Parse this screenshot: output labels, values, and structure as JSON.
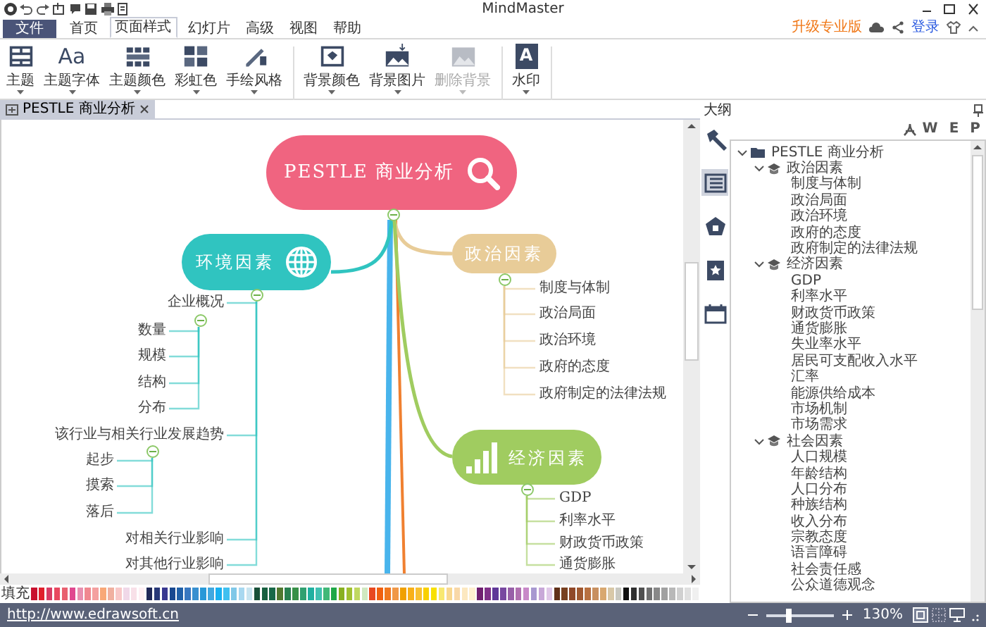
{
  "window": {
    "title": "MindMaster"
  },
  "menu_tabs": [
    {
      "label": "文件",
      "kind": "file",
      "selected": false
    },
    {
      "label": "首页",
      "kind": "tab",
      "selected": false
    },
    {
      "label": "页面样式",
      "kind": "tab",
      "selected": true
    },
    {
      "label": "幻灯片",
      "kind": "tab",
      "selected": false
    },
    {
      "label": "高级",
      "kind": "tab",
      "selected": false
    },
    {
      "label": "视图",
      "kind": "tab",
      "selected": false
    },
    {
      "label": "帮助",
      "kind": "tab",
      "selected": false
    }
  ],
  "account": {
    "upgrade": "升级专业版",
    "login": "登录"
  },
  "ribbon": {
    "groups": [
      {
        "items": [
          {
            "label": "主题",
            "disabled": false
          },
          {
            "label": "主题字体",
            "glyph": "Aa",
            "disabled": false
          },
          {
            "label": "主题颜色",
            "disabled": false
          },
          {
            "label": "彩虹色",
            "disabled": false
          },
          {
            "label": "手绘风格",
            "disabled": false
          }
        ]
      },
      {
        "items": [
          {
            "label": "背景颜色",
            "disabled": false
          },
          {
            "label": "背景图片",
            "disabled": false
          },
          {
            "label": "删除背景",
            "disabled": true
          }
        ]
      },
      {
        "items": [
          {
            "label": "水印",
            "glyph": "A",
            "disabled": false
          }
        ]
      }
    ]
  },
  "document_tabs": [
    {
      "label": "PESTLE 商业分析",
      "selected": true
    }
  ],
  "mind_map": {
    "central": {
      "text": "PESTLE 商业分析",
      "expanded": true
    },
    "branches": [
      {
        "text": "环境因素",
        "color": "#30c4c0",
        "expanded": true,
        "children": [
          {
            "text": "企业概况",
            "expanded": true,
            "children": [
              {
                "text": "数量"
              },
              {
                "text": "规模"
              },
              {
                "text": "结构"
              },
              {
                "text": "分布"
              }
            ]
          },
          {
            "text": "该行业与相关行业发展趋势",
            "expanded": true,
            "children": [
              {
                "text": "起步"
              },
              {
                "text": "摸索"
              },
              {
                "text": "落后"
              }
            ]
          },
          {
            "text": "对相关行业影响"
          },
          {
            "text": "对其他行业影响"
          }
        ]
      },
      {
        "text": "政治因素",
        "color": "#e8cc98",
        "expanded": true,
        "children": [
          {
            "text": "制度与体制"
          },
          {
            "text": "政治局面"
          },
          {
            "text": "政治环境"
          },
          {
            "text": "政府的态度"
          },
          {
            "text": "政府制定的法律法规"
          }
        ]
      },
      {
        "text": "经济因素",
        "color": "#a0cc60",
        "expanded": true,
        "children": [
          {
            "text": "GDP"
          },
          {
            "text": "利率水平"
          },
          {
            "text": "财政货币政策"
          },
          {
            "text": "通货膨胀"
          }
        ]
      }
    ]
  },
  "palette": {
    "label": "填充"
  },
  "outline": {
    "title": "大纲",
    "side_tabs": [
      {
        "selected": false
      },
      {
        "selected": true
      },
      {
        "selected": false
      },
      {
        "selected": false
      },
      {
        "selected": false
      }
    ],
    "export_buttons": [
      "W",
      "E",
      "P"
    ],
    "tree": {
      "text": "PESTLE 商业分析",
      "expanded": true,
      "children": [
        {
          "text": "政治因素",
          "expanded": true,
          "children": [
            {
              "text": "制度与体制"
            },
            {
              "text": "政治局面"
            },
            {
              "text": "政治环境"
            },
            {
              "text": "政府的态度"
            },
            {
              "text": "政府制定的法律法规"
            }
          ]
        },
        {
          "text": "经济因素",
          "expanded": true,
          "children": [
            {
              "text": "GDP"
            },
            {
              "text": "利率水平"
            },
            {
              "text": "财政货币政策"
            },
            {
              "text": "通货膨胀"
            },
            {
              "text": "失业率水平"
            },
            {
              "text": "居民可支配收入水平"
            },
            {
              "text": "汇率"
            },
            {
              "text": "能源供给成本"
            },
            {
              "text": "市场机制"
            },
            {
              "text": "市场需求"
            }
          ]
        },
        {
          "text": "社会因素",
          "expanded": true,
          "children": [
            {
              "text": "人口规模"
            },
            {
              "text": "年龄结构"
            },
            {
              "text": "人口分布"
            },
            {
              "text": "种族结构"
            },
            {
              "text": "收入分布"
            },
            {
              "text": "宗教态度"
            },
            {
              "text": "语言障碍"
            },
            {
              "text": "社会责任感"
            },
            {
              "text": "公众道德观念"
            }
          ]
        }
      ]
    }
  },
  "status_bar": {
    "link": "http://www.edrawsoft.cn",
    "zoom": {
      "level": 0.33,
      "reading": "130%"
    }
  }
}
